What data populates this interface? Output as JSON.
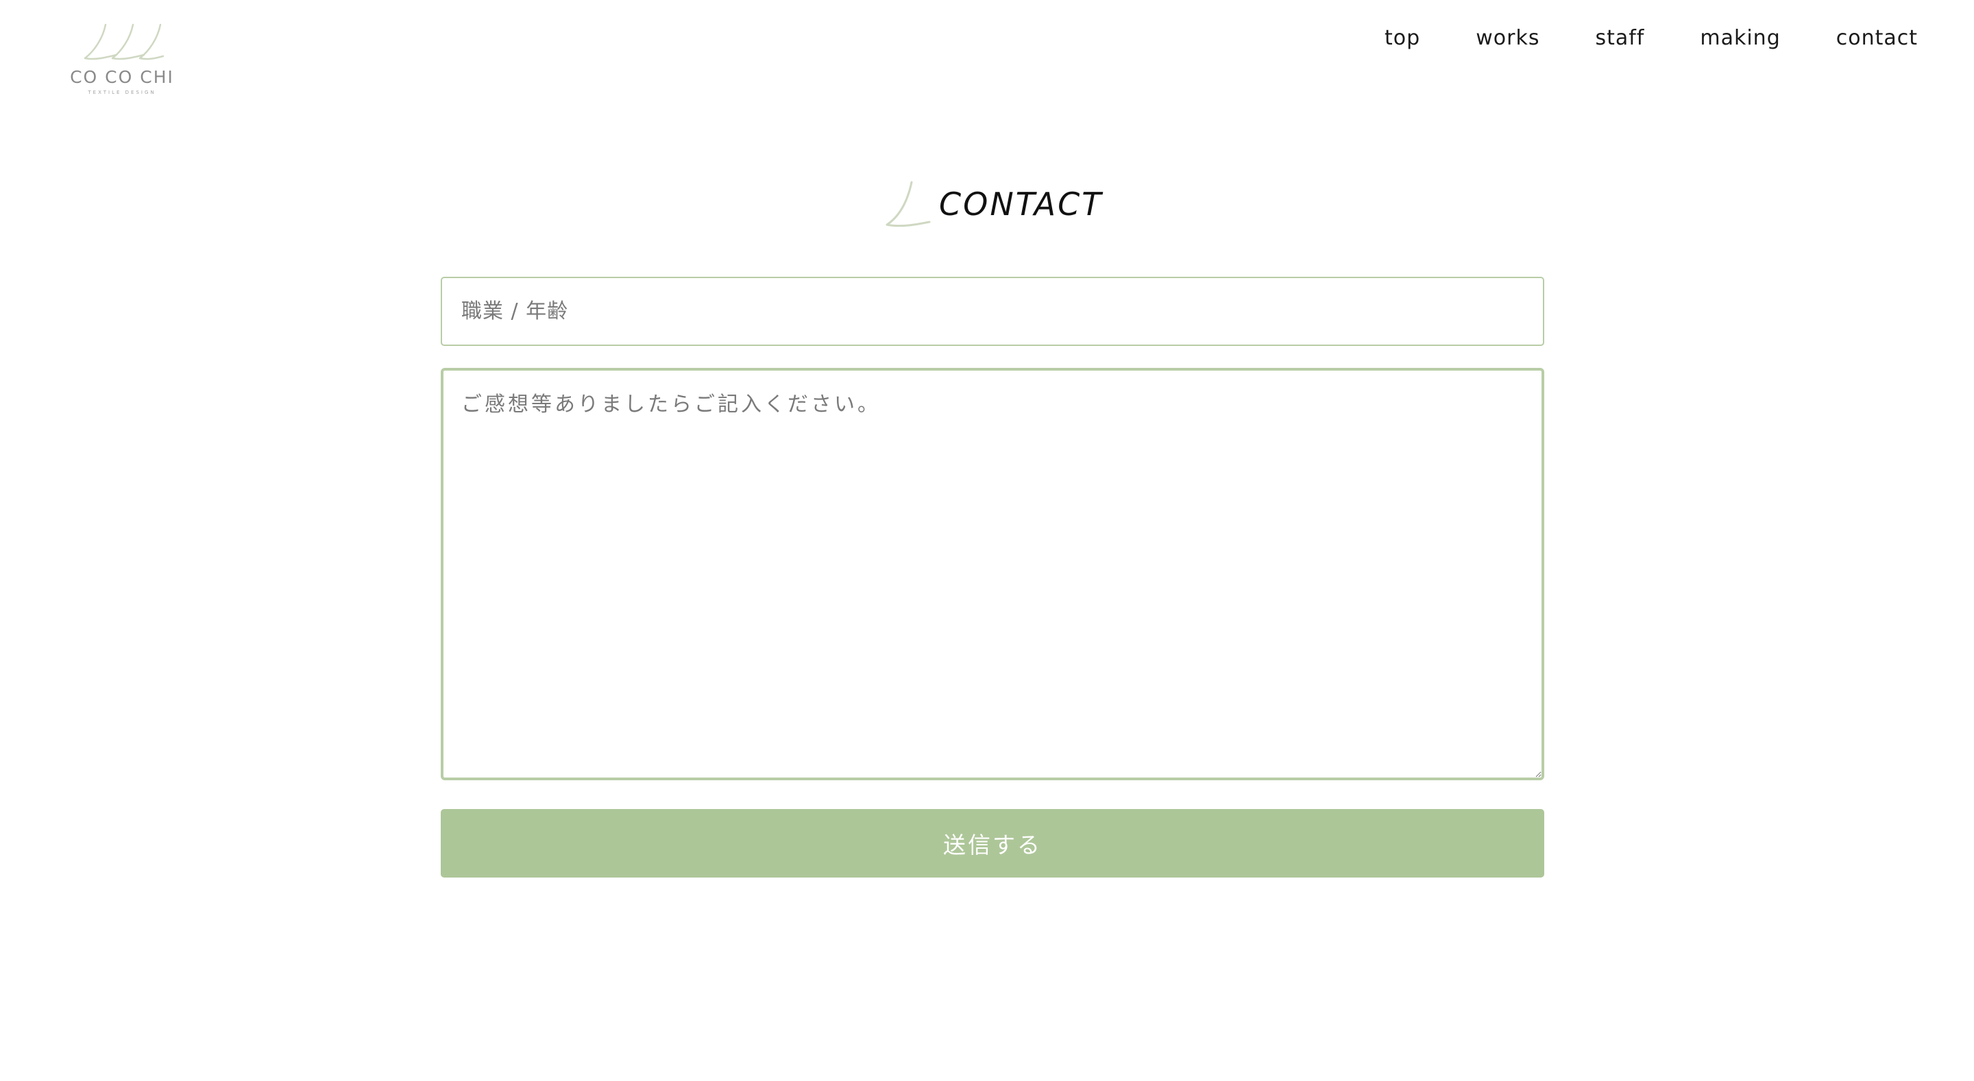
{
  "header": {
    "logo": {
      "wordmark": "CO CO CHI",
      "subtitle": "TEXTILE DESIGN"
    },
    "nav": [
      {
        "label": "top"
      },
      {
        "label": "works"
      },
      {
        "label": "staff"
      },
      {
        "label": "making"
      },
      {
        "label": "contact"
      }
    ]
  },
  "main": {
    "title": "CONTACT",
    "form": {
      "occupation_age": {
        "value": "",
        "placeholder": "職業 / 年齢"
      },
      "message": {
        "value": "",
        "placeholder": "ご感想等ありましたらご記入ください。"
      },
      "submit_label": "送信する"
    }
  },
  "colors": {
    "accent": "#adc698",
    "field_border": "#b8cda6",
    "logo_mark": "#cfd8c2",
    "text": "#1b1b1b",
    "placeholder": "#7a7a7a"
  }
}
